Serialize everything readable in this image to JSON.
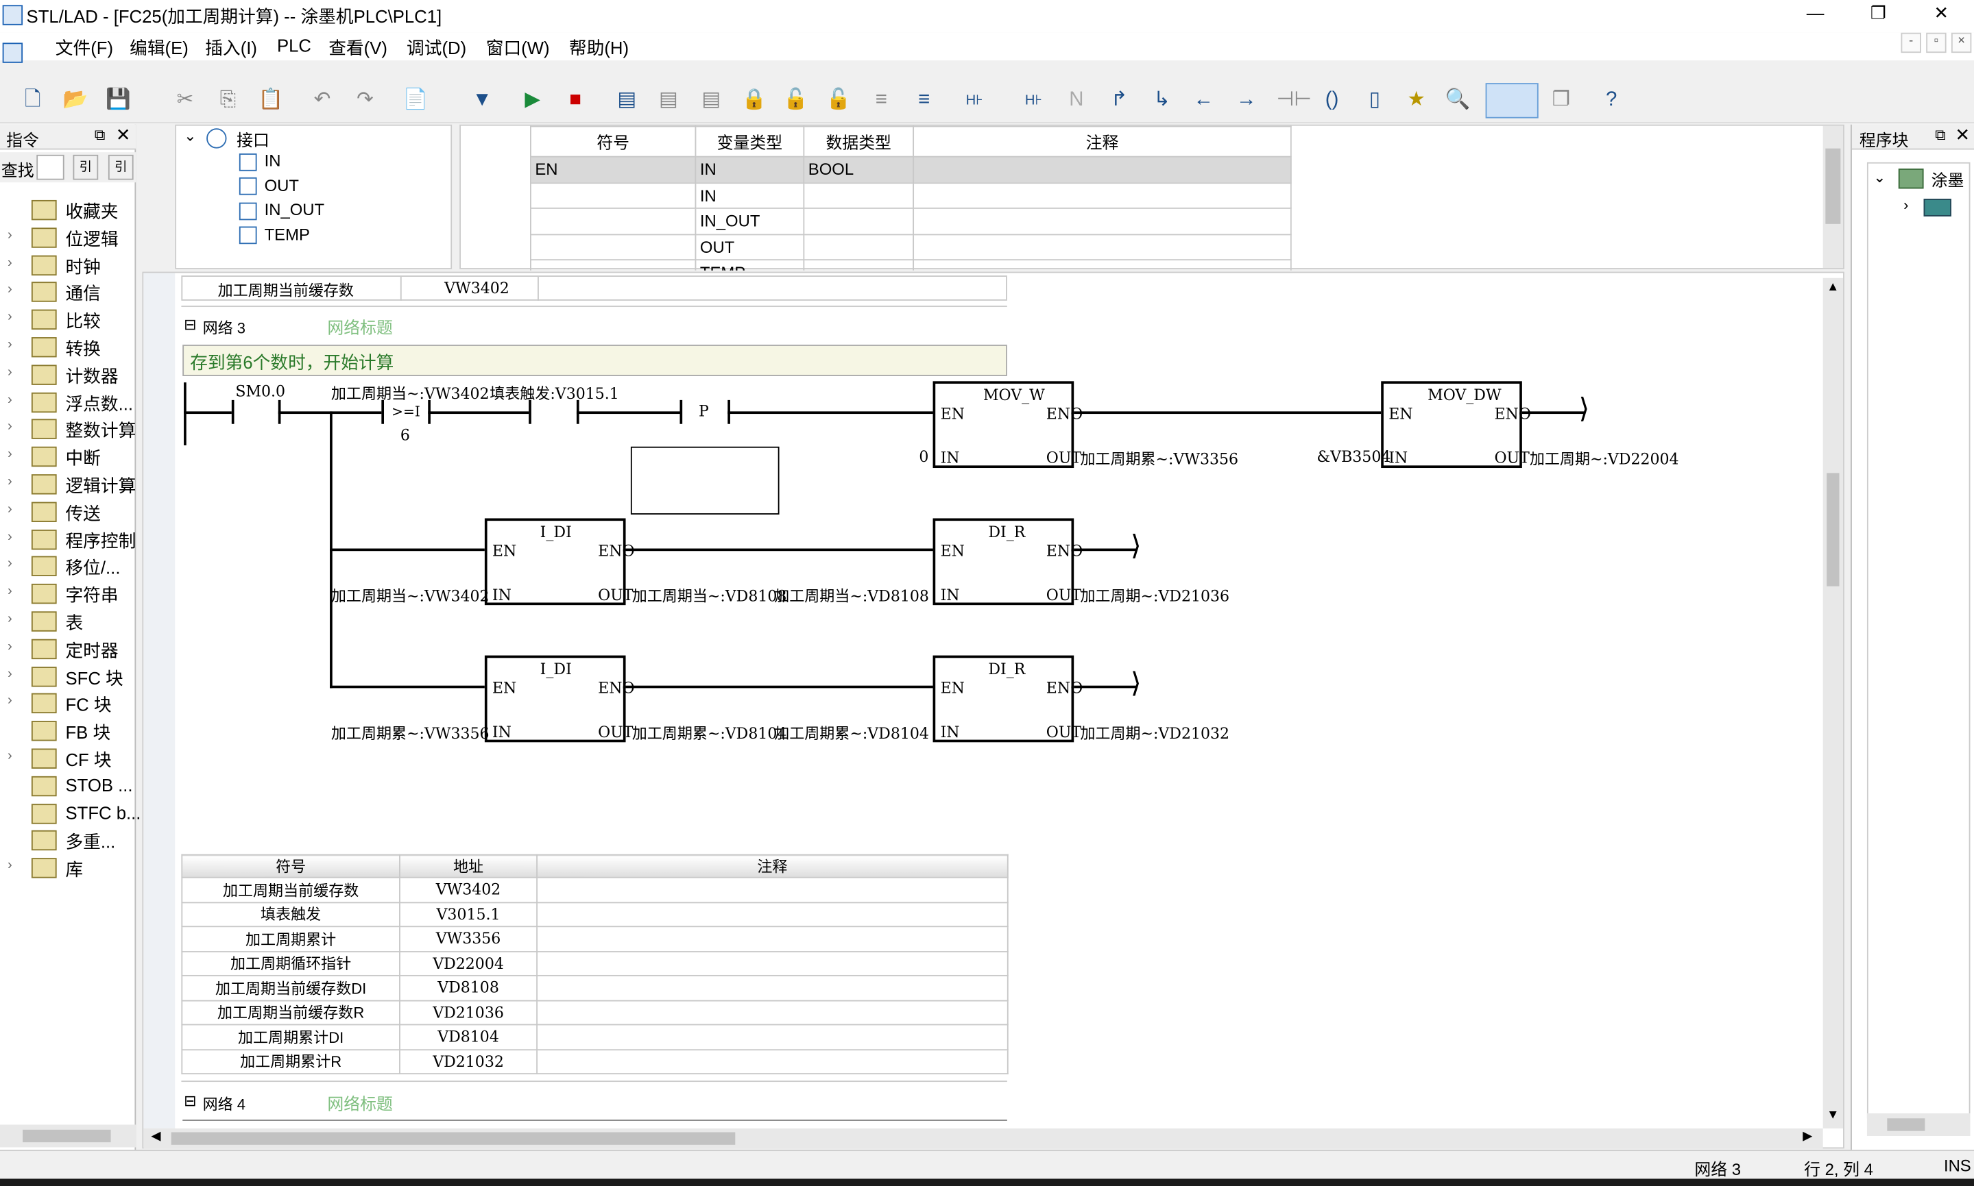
{
  "window": {
    "title": "STL/LAD - [FC25(加工周期计算) -- 涂墨机PLC\\PLC1]",
    "min": "—",
    "max": "❐",
    "close": "✕"
  },
  "menu": [
    "文件(F)",
    "编辑(E)",
    "插入(I)",
    "PLC",
    "查看(V)",
    "调试(D)",
    "窗口(W)",
    "帮助(H)"
  ],
  "mdi": [
    "-",
    "▫",
    "×"
  ],
  "left_panel": {
    "title": "指令",
    "search_label": "查找",
    "items": [
      "收藏夹",
      "位逻辑",
      "时钟",
      "通信",
      "比较",
      "转换",
      "计数器",
      "浮点数...",
      "整数计算",
      "中断",
      "逻辑计算",
      "传送",
      "程序控制",
      "移位/...",
      "字符串",
      "表",
      "定时器",
      "SFC 块",
      "FC 块",
      "FB 块",
      "CF 块",
      "STOB ...",
      "STFC b...",
      "多重...",
      "库"
    ]
  },
  "iface": {
    "root": "接口",
    "children": [
      "IN",
      "OUT",
      "IN_OUT",
      "TEMP"
    ]
  },
  "vartable": {
    "headers": [
      "符号",
      "变量类型",
      "数据类型",
      "注释"
    ],
    "rows": [
      [
        "EN",
        "IN",
        "BOOL",
        ""
      ],
      [
        "",
        "IN",
        "",
        ""
      ],
      [
        "",
        "IN_OUT",
        "",
        ""
      ],
      [
        "",
        "OUT",
        "",
        ""
      ],
      [
        "",
        "TEMP",
        "",
        ""
      ]
    ]
  },
  "prev_row": {
    "symbol": "加工周期当前缓存数",
    "addr": "VW3402"
  },
  "network3": {
    "label": "网络 3",
    "title_placeholder": "网络标题",
    "comment": "存到第6个数时，开始计算",
    "contact1": "SM0.0",
    "cmp_label": "加工周期当~:VW3402",
    "cmp_op": ">=I",
    "cmp_val": "6",
    "contact3": "填表触发:V3015.1",
    "p": "P",
    "mov_w": {
      "name": "MOV_W",
      "en": "EN",
      "eno": "ENO",
      "in": "IN",
      "out": "OUT",
      "in_val": "0",
      "out_val": "加工周期累~:VW3356"
    },
    "mov_dw": {
      "name": "MOV_DW",
      "en": "EN",
      "eno": "ENO",
      "in": "IN",
      "out": "OUT",
      "in_val": "&VB3504",
      "out_val": "加工周期~:VD22004"
    },
    "idi1": {
      "name": "I_DI",
      "en": "EN",
      "eno": "ENO",
      "in": "IN",
      "out": "OUT",
      "in_val": "加工周期当~:VW3402",
      "out_val": "加工周期当~:VD8108"
    },
    "dir1": {
      "name": "DI_R",
      "en": "EN",
      "eno": "ENO",
      "in": "IN",
      "out": "OUT",
      "in_val": "加工周期当~:VD8108",
      "out_val": "加工周期~:VD21036"
    },
    "idi2": {
      "name": "I_DI",
      "en": "EN",
      "eno": "ENO",
      "in": "IN",
      "out": "OUT",
      "in_val": "加工周期累~:VW3356",
      "out_val": "加工周期累~:VD8104"
    },
    "dir2": {
      "name": "DI_R",
      "en": "EN",
      "eno": "ENO",
      "in": "IN",
      "out": "OUT",
      "in_val": "加工周期累~:VD8104",
      "out_val": "加工周期~:VD21032"
    }
  },
  "symtable": {
    "headers": [
      "符号",
      "地址",
      "注释"
    ],
    "rows": [
      [
        "加工周期当前缓存数",
        "VW3402",
        ""
      ],
      [
        "填表触发",
        "V3015.1",
        ""
      ],
      [
        "加工周期累计",
        "VW3356",
        ""
      ],
      [
        "加工周期循环指针",
        "VD22004",
        ""
      ],
      [
        "加工周期当前缓存数DI",
        "VD8108",
        ""
      ],
      [
        "加工周期当前缓存数R",
        "VD21036",
        ""
      ],
      [
        "加工周期累计DI",
        "VD8104",
        ""
      ],
      [
        "加工周期累计R",
        "VD21032",
        ""
      ]
    ]
  },
  "network4": {
    "label": "网络 4",
    "title_placeholder": "网络标题"
  },
  "right_panel": {
    "title": "程序块",
    "root": "涂墨"
  },
  "status": {
    "network": "网络 3",
    "pos": "行 2,  列 4",
    "mode": "INS"
  },
  "colors": {
    "title_placeholder": "#7fbf7f",
    "comment_bg": "#f6f6e4",
    "comment_text": "#2a7a2a",
    "selected_row": "#d9d9d9"
  }
}
